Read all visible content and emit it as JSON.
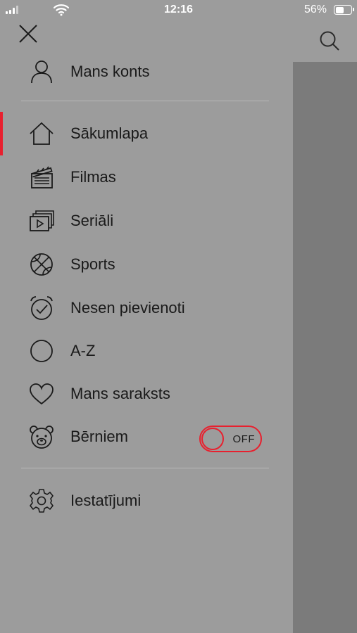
{
  "status_bar": {
    "time": "12:16",
    "battery_percent_text": "56%",
    "battery_level": 0.56
  },
  "drawer": {
    "account": {
      "label": "Mans konts",
      "icon": "user-icon"
    },
    "menu": [
      {
        "label": "Sākumlapa",
        "icon": "home-icon",
        "active": true
      },
      {
        "label": "Filmas",
        "icon": "clapperboard-icon",
        "active": false
      },
      {
        "label": "Seriāli",
        "icon": "series-icon",
        "active": false
      },
      {
        "label": "Sports",
        "icon": "basketball-icon",
        "active": false
      },
      {
        "label": "Nesen pievienoti",
        "icon": "alarm-check-icon",
        "active": false
      },
      {
        "label": "A-Z",
        "icon": "circle-icon",
        "active": false
      },
      {
        "label": "Mans saraksts",
        "icon": "heart-icon",
        "active": false
      },
      {
        "label": "Bērniem",
        "icon": "bear-icon",
        "active": false
      }
    ],
    "kids_toggle": {
      "label": "OFF",
      "state": false
    },
    "settings": {
      "label": "Iestatījumi",
      "icon": "gear-icon"
    }
  },
  "colors": {
    "accent": "#e8202e",
    "drawer_bg": "#9c9c9c",
    "backdrop": "#7b7b7b"
  }
}
